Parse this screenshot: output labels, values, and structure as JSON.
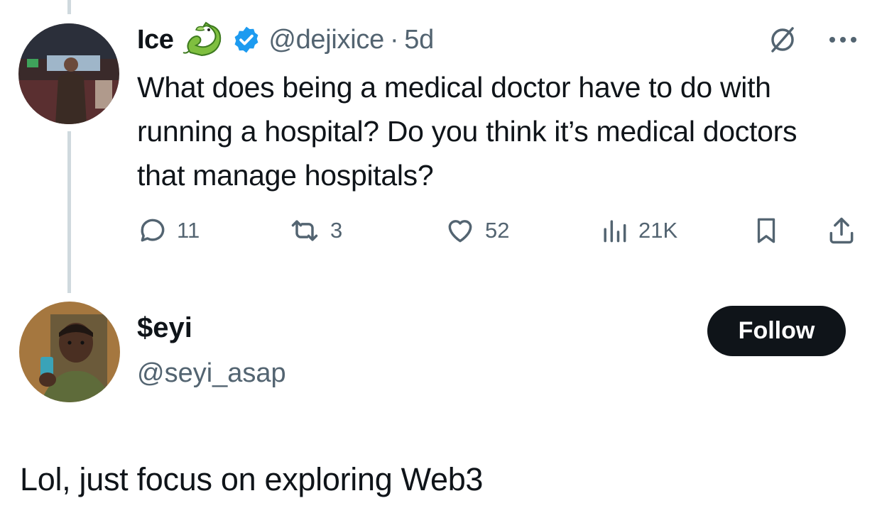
{
  "parent_tweet": {
    "author_name": "Ice",
    "author_handle": "@dejixice",
    "separator": "·",
    "timestamp": "5d",
    "emoji_icon": "dragon-emoji",
    "verified_icon": "verified-badge-icon",
    "text": "What does being a medical doctor have to do with running a hospital? Do you think it’s medical doctors that manage hospitals?",
    "actions": {
      "replies": "11",
      "reposts": "3",
      "likes": "52",
      "views": "21K"
    }
  },
  "reply_author": {
    "name": "$eyi",
    "handle": "@seyi_asap",
    "follow_label": "Follow"
  },
  "reply_text": "Lol, just focus on exploring Web3",
  "colors": {
    "text_primary": "#0f1419",
    "text_secondary": "#536471",
    "verified_blue": "#1d9bf0",
    "thread_line": "#cfd9de",
    "follow_bg": "#0f1419"
  }
}
